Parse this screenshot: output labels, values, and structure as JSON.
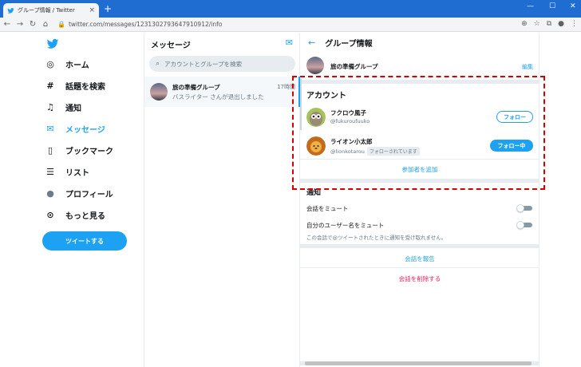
{
  "browser": {
    "tab_title": "グループ情報 / Twitter",
    "tab_close": "×",
    "new_tab": "+",
    "window_controls": {
      "minimize": "—",
      "maximize": "☐",
      "close": "✕"
    },
    "url": "twitter.com/messages/1231302793647910912/info",
    "nav": {
      "back": "←",
      "forward": "→",
      "reload": "↻",
      "home": "⌂"
    },
    "lock": "🔒",
    "toolbar_icons": [
      "⊕",
      "☆",
      "⧉",
      "●",
      "⋮"
    ]
  },
  "sidebar": {
    "items": [
      {
        "label": "ホーム",
        "icon": "◎"
      },
      {
        "label": "話題を検索",
        "icon": "#"
      },
      {
        "label": "通知",
        "icon": "♫"
      },
      {
        "label": "メッセージ",
        "icon": "✉"
      },
      {
        "label": "ブックマーク",
        "icon": "▯"
      },
      {
        "label": "リスト",
        "icon": "☰"
      },
      {
        "label": "プロフィール",
        "icon": "●"
      },
      {
        "label": "もっと見る",
        "icon": "⊙"
      }
    ],
    "tweet_button": "ツイートする",
    "accent": "#1da1f2"
  },
  "messages": {
    "title": "メッセージ",
    "compose_icon": "✉",
    "search_icon": "⌕",
    "search_placeholder": "アカウントとグループを検索",
    "conversation": {
      "name": "旅の準備グループ",
      "time": "17時間",
      "preview": "バスライター さんが退出しました"
    }
  },
  "info": {
    "back_icon": "←",
    "title": "グループ情報",
    "group_name": "旅の準備グループ",
    "edit": "編集",
    "account_section": "アカウント",
    "members": [
      {
        "name": "フクロウ風子",
        "handle": "@fukuroufuuko",
        "button": "フォロー",
        "follows_you": ""
      },
      {
        "name": "ライオン小太郎",
        "handle": "@lionkotarou",
        "button": "フォロー中",
        "follows_you": "フォローされています"
      }
    ],
    "add_participant": "参加者を追加",
    "notify_section": "通知",
    "mute_conversation": "会話をミュート",
    "mute_mentions": "自分のユーザー名をミュート",
    "mute_note": "この会話で@ツイートされたときに通知を受け取れません。",
    "report": "会話を報告",
    "delete": "会話を削除する"
  }
}
